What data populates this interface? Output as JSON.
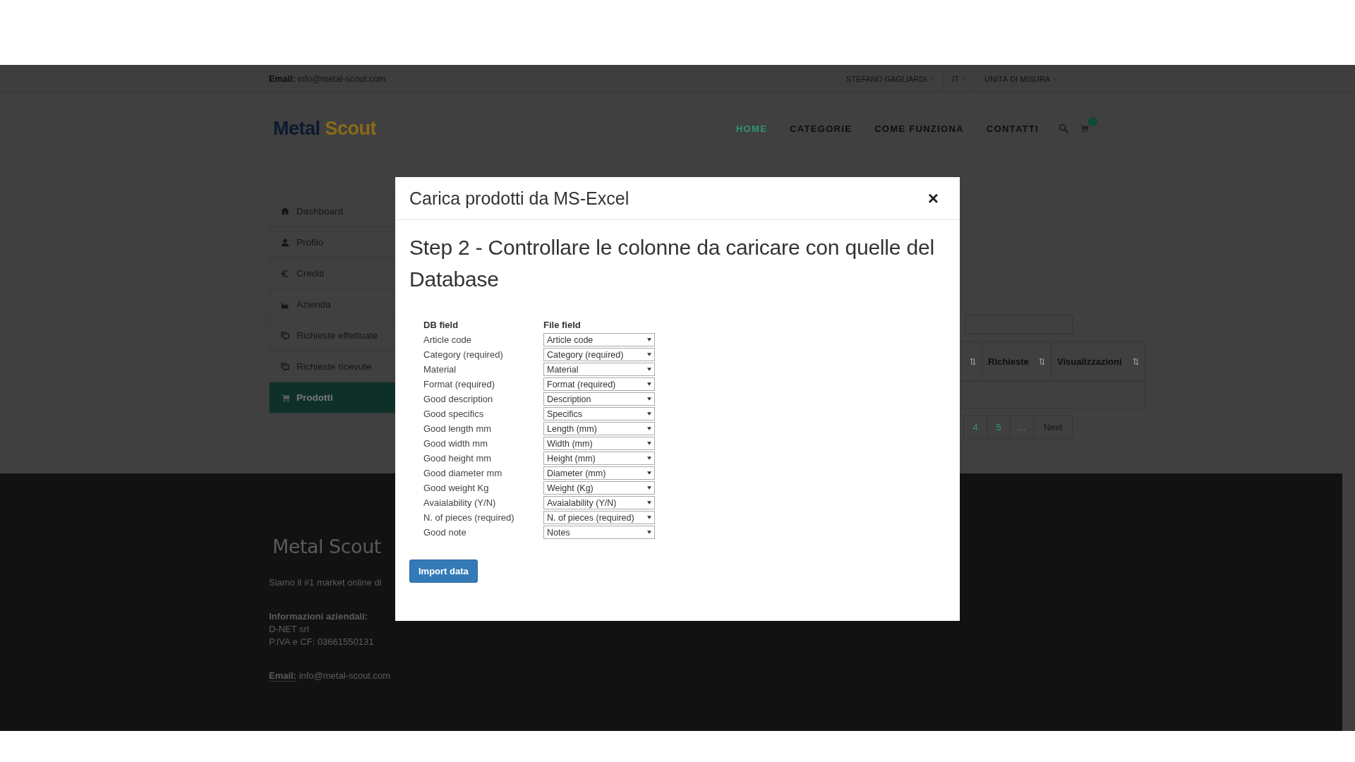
{
  "top_bar": {
    "email_label": "Email:",
    "email": "info@metal-scout.com",
    "menus": [
      "STEFANO GAGLIARDI",
      "IT",
      "UNITÀ DI MISURA"
    ]
  },
  "header": {
    "logo": {
      "part_1": "Metal",
      "part_2": "Scout"
    },
    "nav": [
      {
        "label": "HOME",
        "selected": true
      },
      {
        "label": "CATEGORIE",
        "selected": false
      },
      {
        "label": "COME FUNZIONA",
        "selected": false
      },
      {
        "label": "CONTATTI",
        "selected": false
      }
    ]
  },
  "sidebar": {
    "items": [
      {
        "label": "Dashboard",
        "kind": "home",
        "selected": false
      },
      {
        "label": "Profilo",
        "kind": "user",
        "selected": false
      },
      {
        "label": "Crediti",
        "kind": "euro",
        "selected": false
      },
      {
        "label": "Azienda",
        "kind": "industry",
        "selected": false
      },
      {
        "label": "Richieste effettuate",
        "kind": "comments",
        "selected": false
      },
      {
        "label": "Richieste ricevute",
        "kind": "comments",
        "selected": false
      },
      {
        "label": "Prodotti",
        "kind": "cart",
        "selected": true
      }
    ]
  },
  "products": {
    "columns": [
      "Richieste",
      "Visualizzazioni"
    ],
    "pagination": [
      "4",
      "5",
      "...",
      "Next"
    ]
  },
  "modal": {
    "title": "Carica prodotti da MS-Excel",
    "close": "×",
    "heading": "Step 2 - Controllare le colonne da caricare con quelle del Database",
    "columns": [
      "DB field",
      "File field"
    ],
    "rows": [
      {
        "db_field": "Article code",
        "file_field": "Article code"
      },
      {
        "db_field": "Category (required)",
        "file_field": "Category (required)"
      },
      {
        "db_field": "Material",
        "file_field": "Material"
      },
      {
        "db_field": "Format (required)",
        "file_field": "Format (required)"
      },
      {
        "db_field": "Good description",
        "file_field": "Description"
      },
      {
        "db_field": "Good specifics",
        "file_field": "Specifics"
      },
      {
        "db_field": "Good length mm",
        "file_field": "Length (mm)"
      },
      {
        "db_field": "Good width mm",
        "file_field": "Width (mm)"
      },
      {
        "db_field": "Good height mm",
        "file_field": "Height (mm)"
      },
      {
        "db_field": "Good diameter mm",
        "file_field": "Diameter (mm)"
      },
      {
        "db_field": "Good weight Kg",
        "file_field": "Weight (Kg)"
      },
      {
        "db_field": "Avaialability (Y/N)",
        "file_field": "Avaialability (Y/N)"
      },
      {
        "db_field": "N. of pieces (required)",
        "file_field": "N. of pieces (required)"
      },
      {
        "db_field": "Good note",
        "file_field": "Notes"
      }
    ],
    "button": "Import data"
  },
  "footer": {
    "logo": "Metal Scout",
    "tagline": "Siamo il #1 market online di",
    "company_label": "Informazioni aziendali:",
    "company_lines": [
      "D-NET srl",
      "P.IVA e CF: 03661550131"
    ],
    "email_label": "Email:",
    "email": "info@metal-scout.com"
  }
}
